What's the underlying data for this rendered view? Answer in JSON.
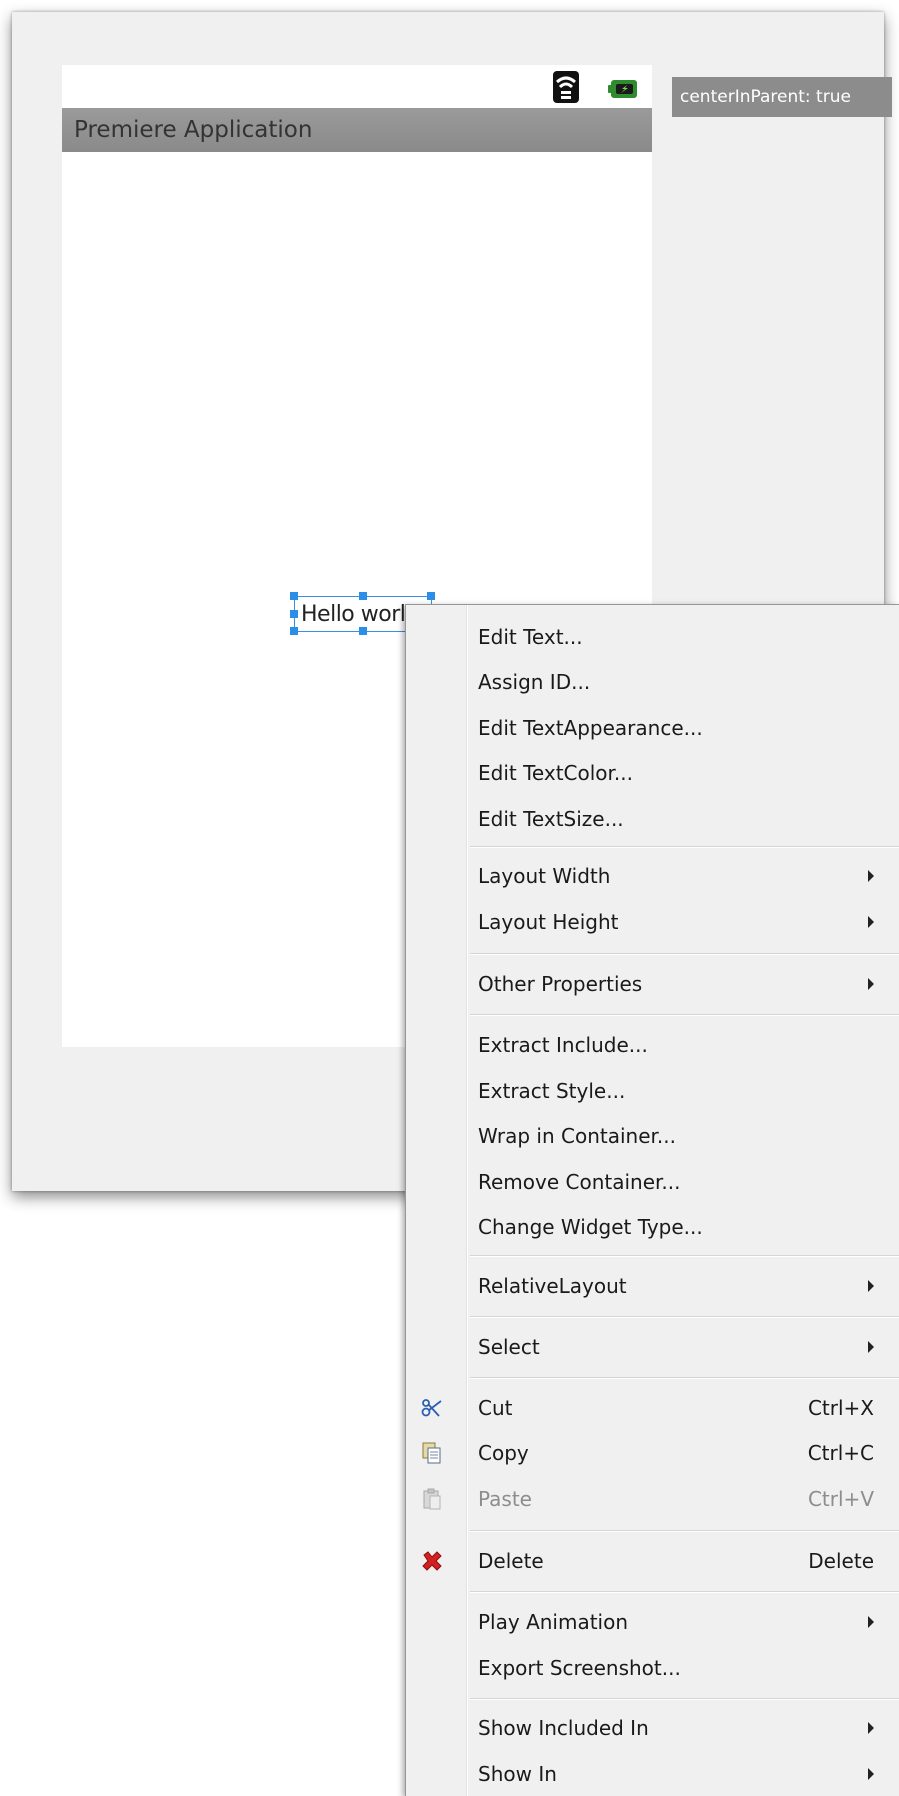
{
  "designer": {
    "app_title": "Premiere Application",
    "tooltip_text": "centerInParent: true",
    "hello_text": "Hello world!",
    "status_icons": [
      "wifi-signal-icon",
      "battery-icon"
    ]
  },
  "context_menu": {
    "items": [
      {
        "label": "Edit Text..."
      },
      {
        "label": "Assign ID..."
      },
      {
        "label": "Edit TextAppearance..."
      },
      {
        "label": "Edit TextColor..."
      },
      {
        "label": "Edit TextSize..."
      },
      {
        "label": "Layout Width",
        "submenu": true
      },
      {
        "label": "Layout Height",
        "submenu": true
      },
      {
        "label": "Other Properties",
        "submenu": true
      },
      {
        "label": "Extract Include..."
      },
      {
        "label": "Extract Style..."
      },
      {
        "label": "Wrap in Container..."
      },
      {
        "label": "Remove Container..."
      },
      {
        "label": "Change Widget Type..."
      },
      {
        "label": "RelativeLayout",
        "submenu": true
      },
      {
        "label": "Select",
        "submenu": true
      },
      {
        "label": "Cut",
        "shortcut": "Ctrl+X",
        "icon": "scissors-icon"
      },
      {
        "label": "Copy",
        "shortcut": "Ctrl+C",
        "icon": "copy-icon"
      },
      {
        "label": "Paste",
        "shortcut": "Ctrl+V",
        "icon": "paste-icon",
        "disabled": true
      },
      {
        "label": "Delete",
        "shortcut": "Delete",
        "icon": "delete-icon"
      },
      {
        "label": "Play Animation",
        "submenu": true
      },
      {
        "label": "Export Screenshot..."
      },
      {
        "label": "Show Included In",
        "submenu": true
      },
      {
        "label": "Show In",
        "submenu": true
      }
    ]
  },
  "colors": {
    "selection_accent": "#2b8fe8",
    "title_bar": "#8f8f8f",
    "delete_icon": "#d42020",
    "menu_background": "#f0f0f0"
  }
}
